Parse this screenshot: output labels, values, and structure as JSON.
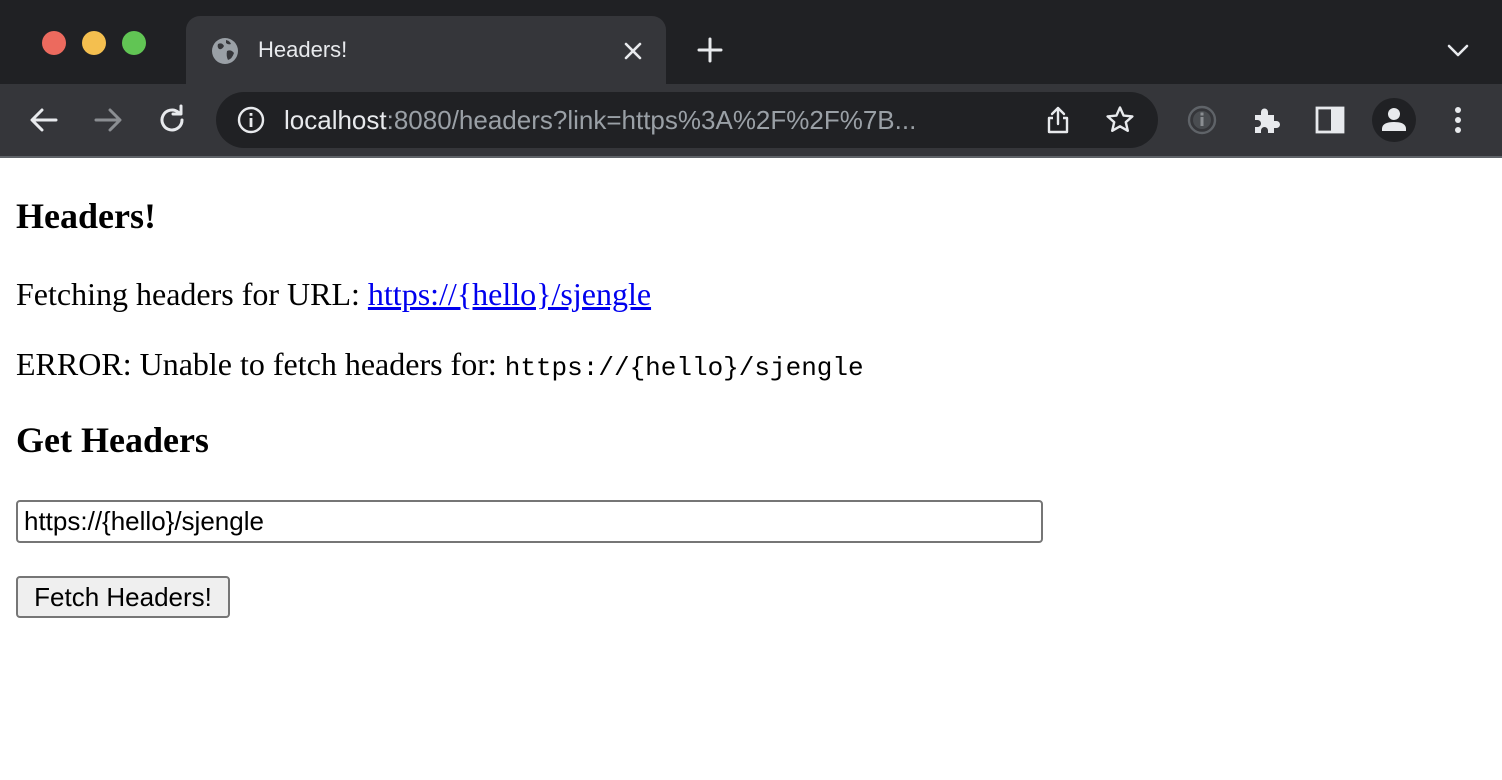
{
  "browser": {
    "tab": {
      "title": "Headers!",
      "icon": "globe-icon"
    },
    "omnibox": {
      "host": "localhost",
      "rest": ":8080/headers?link=https%3A%2F%2F%7B..."
    },
    "icons": {
      "back": "arrow-left-icon",
      "forward": "arrow-right-icon",
      "reload": "reload-icon",
      "info": "info-icon",
      "share": "share-icon",
      "bookmark": "star-icon",
      "extension": "puzzle-icon",
      "side_panel": "side-panel-icon",
      "profile": "person-icon",
      "menu": "kebab-menu-icon"
    },
    "colors": {
      "frame": "#202124",
      "toolbar": "#35363a",
      "link": "#0000ee"
    }
  },
  "page": {
    "heading": "Headers!",
    "fetching_prefix": "Fetching headers for URL: ",
    "fetching_link": "https://{hello}/sjengle",
    "error_prefix": "ERROR: Unable to fetch headers for: ",
    "error_url": "https://{hello}/sjengle",
    "form_heading": "Get Headers",
    "input_value": "https://{hello}/sjengle",
    "submit_label": "Fetch Headers!"
  }
}
